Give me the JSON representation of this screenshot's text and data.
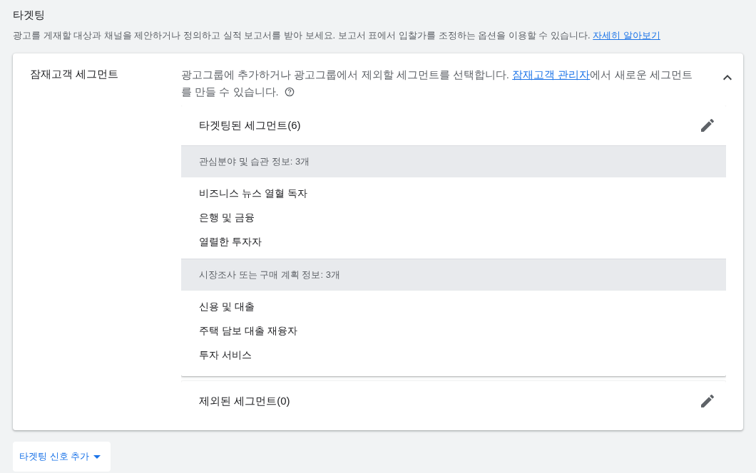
{
  "header": {
    "title": "타겟팅",
    "description": "광고를 게재할 대상과 채널을 제안하거나 정의하고 실적 보고서를 받아 보세요. 보고서 표에서 입찰가를 조정하는 옵션을 이용할 수 있습니다.",
    "link": "자세히 알아보기"
  },
  "section": {
    "label": "잠재고객 세그먼트",
    "expanded": true,
    "description_before": "광고그룹에 추가하거나 광고그룹에서 제외할 세그먼트를 선택합니다. ",
    "description_link": "잠재고객 관리자",
    "description_after": "에서 새로운 세그먼트를 만들 수 있습니다.",
    "panels": [
      {
        "title": "타겟팅된 세그먼트(6)",
        "groups": [
          {
            "heading": "관심분야 및 습관 정보: 3개",
            "items": [
              "비즈니스 뉴스 열혈 독자",
              "은행 및 금융",
              "열렬한 투자자"
            ]
          },
          {
            "heading": "시장조사 또는 구매 계획 정보: 3개",
            "items": [
              "신용 및 대출",
              "주택 담보 대출 재융자",
              "투자 서비스"
            ]
          }
        ]
      },
      {
        "title": "제외된 세그먼트(0)"
      }
    ]
  },
  "add_button": {
    "label": "타겟팅 신호 추가"
  }
}
